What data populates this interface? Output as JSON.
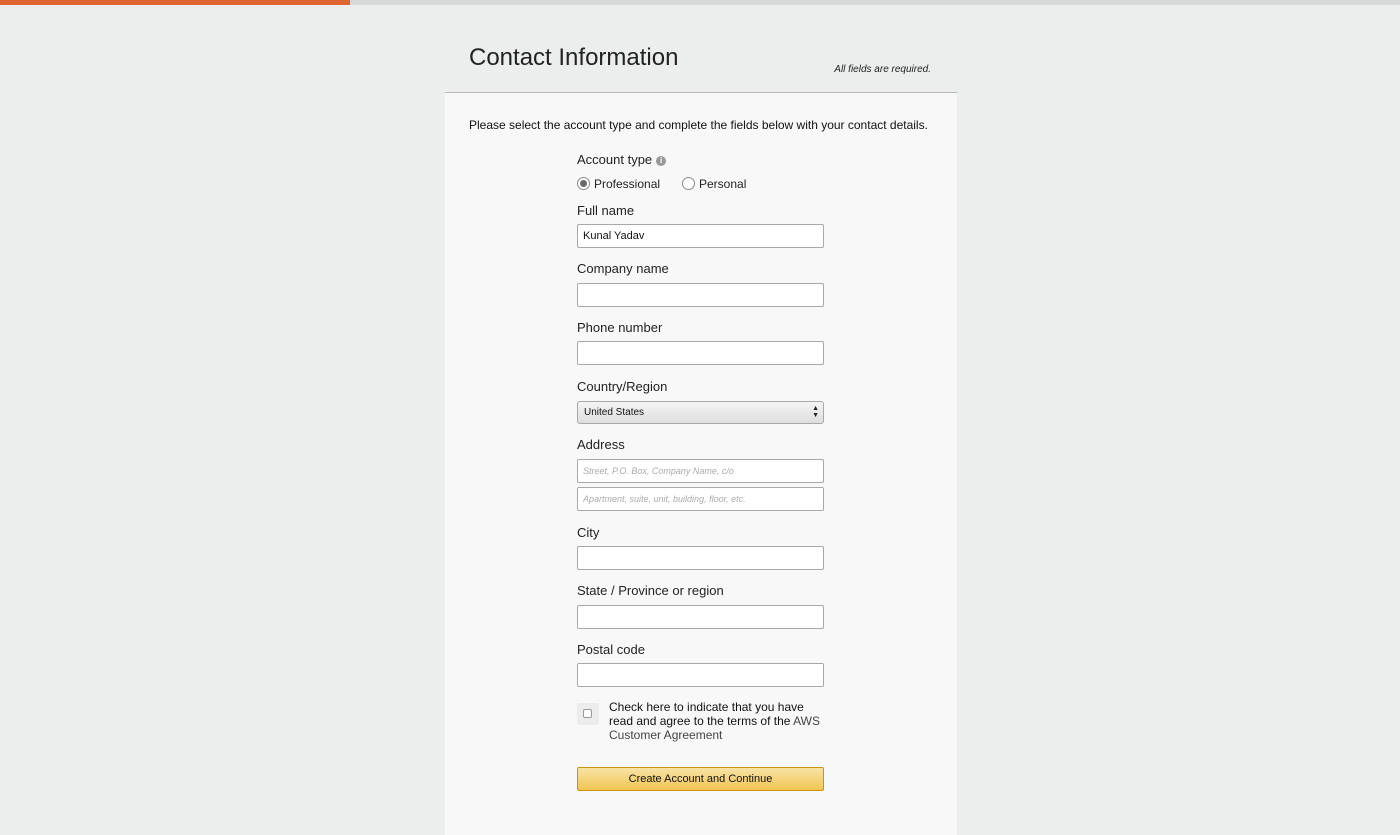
{
  "colors": {
    "accent": "#e0642f",
    "button_bg": "#f1c451",
    "panel_bg": "#f8f8f8",
    "page_bg": "#eceeed"
  },
  "progress": {
    "value": 0.25
  },
  "header": {
    "title": "Contact Information",
    "required_note": "All fields are required."
  },
  "intro": "Please select the account type and complete the fields below with your contact details.",
  "account_type": {
    "label": "Account type",
    "info_icon": "i",
    "options": [
      {
        "label": "Professional",
        "checked": true
      },
      {
        "label": "Personal",
        "checked": false
      }
    ]
  },
  "fields": {
    "full_name": {
      "label": "Full name",
      "value": "Kunal Yadav"
    },
    "company_name": {
      "label": "Company name",
      "value": ""
    },
    "phone_number": {
      "label": "Phone number",
      "value": ""
    },
    "country": {
      "label": "Country/Region",
      "value": "United States"
    },
    "address": {
      "label": "Address",
      "line1_placeholder": "Street, P.O. Box, Company Name, c/o",
      "line2_placeholder": "Apartment, suite, unit, building, floor, etc."
    },
    "city": {
      "label": "City",
      "value": ""
    },
    "state": {
      "label": "State / Province or region",
      "value": ""
    },
    "postal_code": {
      "label": "Postal code",
      "value": ""
    }
  },
  "agreement": {
    "text": "Check here to indicate that you have read and agree to the terms of the",
    "link": "AWS Customer Agreement",
    "checked": false
  },
  "submit_label": "Create Account and Continue"
}
